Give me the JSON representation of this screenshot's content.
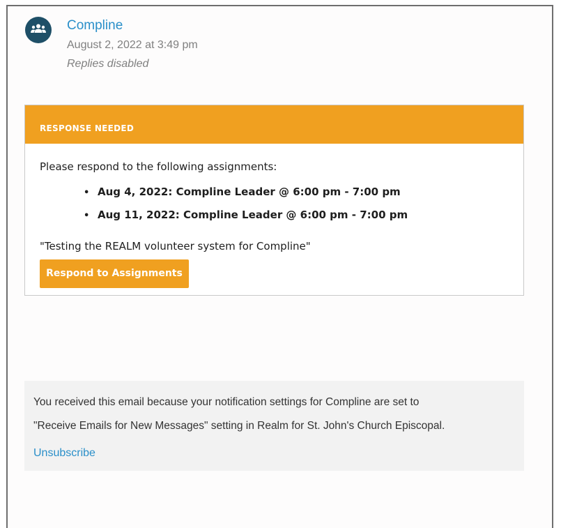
{
  "message": {
    "sender": "Compline",
    "date": "August 2, 2022 at 3:49 pm",
    "replies_status": "Replies disabled",
    "avatar_icon": "group-icon"
  },
  "card": {
    "header": "RESPONSE NEEDED",
    "intro": "Please respond to the following assignments:",
    "assignments": [
      "Aug 4, 2022: Compline Leader @ 6:00 pm - 7:00 pm",
      "Aug 11, 2022: Compline Leader @ 6:00 pm - 7:00 pm"
    ],
    "quote": "\"Testing the REALM volunteer system for Compline\"",
    "button_label": "Respond to Assignments"
  },
  "footer": {
    "line1": "You received this email because your notification settings for Compline are set to",
    "line2": "\"Receive Emails for New Messages\" setting in Realm for St. John's Church Episcopal.",
    "unsubscribe_label": "Unsubscribe"
  },
  "colors": {
    "accent_orange": "#f0a020",
    "link_blue": "#2a8fc9",
    "avatar_navy": "#1e4f67",
    "footer_bg": "#f2f2f2"
  }
}
